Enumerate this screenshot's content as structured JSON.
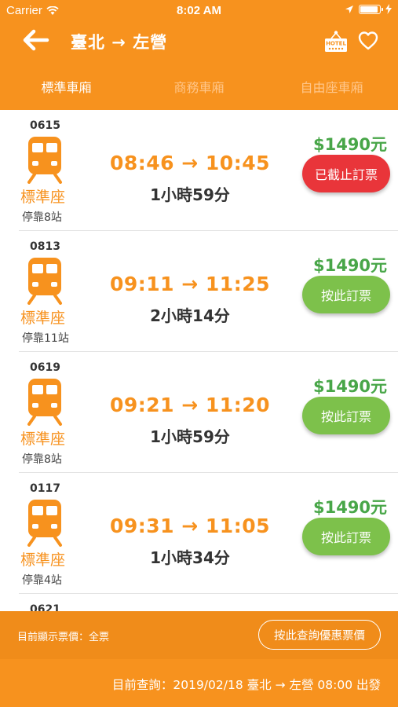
{
  "status_bar": {
    "carrier": "Carrier",
    "time": "8:02 AM"
  },
  "header": {
    "title": "臺北 → 左營",
    "hotel_icon_text": "HOTEL",
    "tabs": [
      {
        "label": "標準車廂",
        "active": true
      },
      {
        "label": "商務車廂",
        "active": false
      },
      {
        "label": "自由座車廂",
        "active": false
      }
    ]
  },
  "trains": [
    {
      "number": "0615",
      "seat": "標準座",
      "stops": "停靠8站",
      "times": "08:46 → 10:45",
      "duration": "1小時59分",
      "price": "$1490元",
      "button": "已截止訂票",
      "closed": true
    },
    {
      "number": "0813",
      "seat": "標準座",
      "stops": "停靠11站",
      "times": "09:11 → 11:25",
      "duration": "2小時14分",
      "price": "$1490元",
      "button": "按此訂票",
      "closed": false
    },
    {
      "number": "0619",
      "seat": "標準座",
      "stops": "停靠8站",
      "times": "09:21 → 11:20",
      "duration": "1小時59分",
      "price": "$1490元",
      "button": "按此訂票",
      "closed": false
    },
    {
      "number": "0117",
      "seat": "標準座",
      "stops": "停靠4站",
      "times": "09:31 → 11:05",
      "duration": "1小時34分",
      "price": "$1490元",
      "button": "按此訂票",
      "closed": false
    },
    {
      "number": "0621"
    }
  ],
  "footer": {
    "price_type": "目前顯示票價：全票",
    "discount_button": "按此查詢優惠票價",
    "query": "目前查詢：2019/02/18 臺北 → 左營 08:00 出發"
  },
  "colors": {
    "brand_orange": "#F7921E",
    "price_green": "#48A648",
    "book_green": "#7DC14B",
    "closed_red": "#E9353A"
  }
}
